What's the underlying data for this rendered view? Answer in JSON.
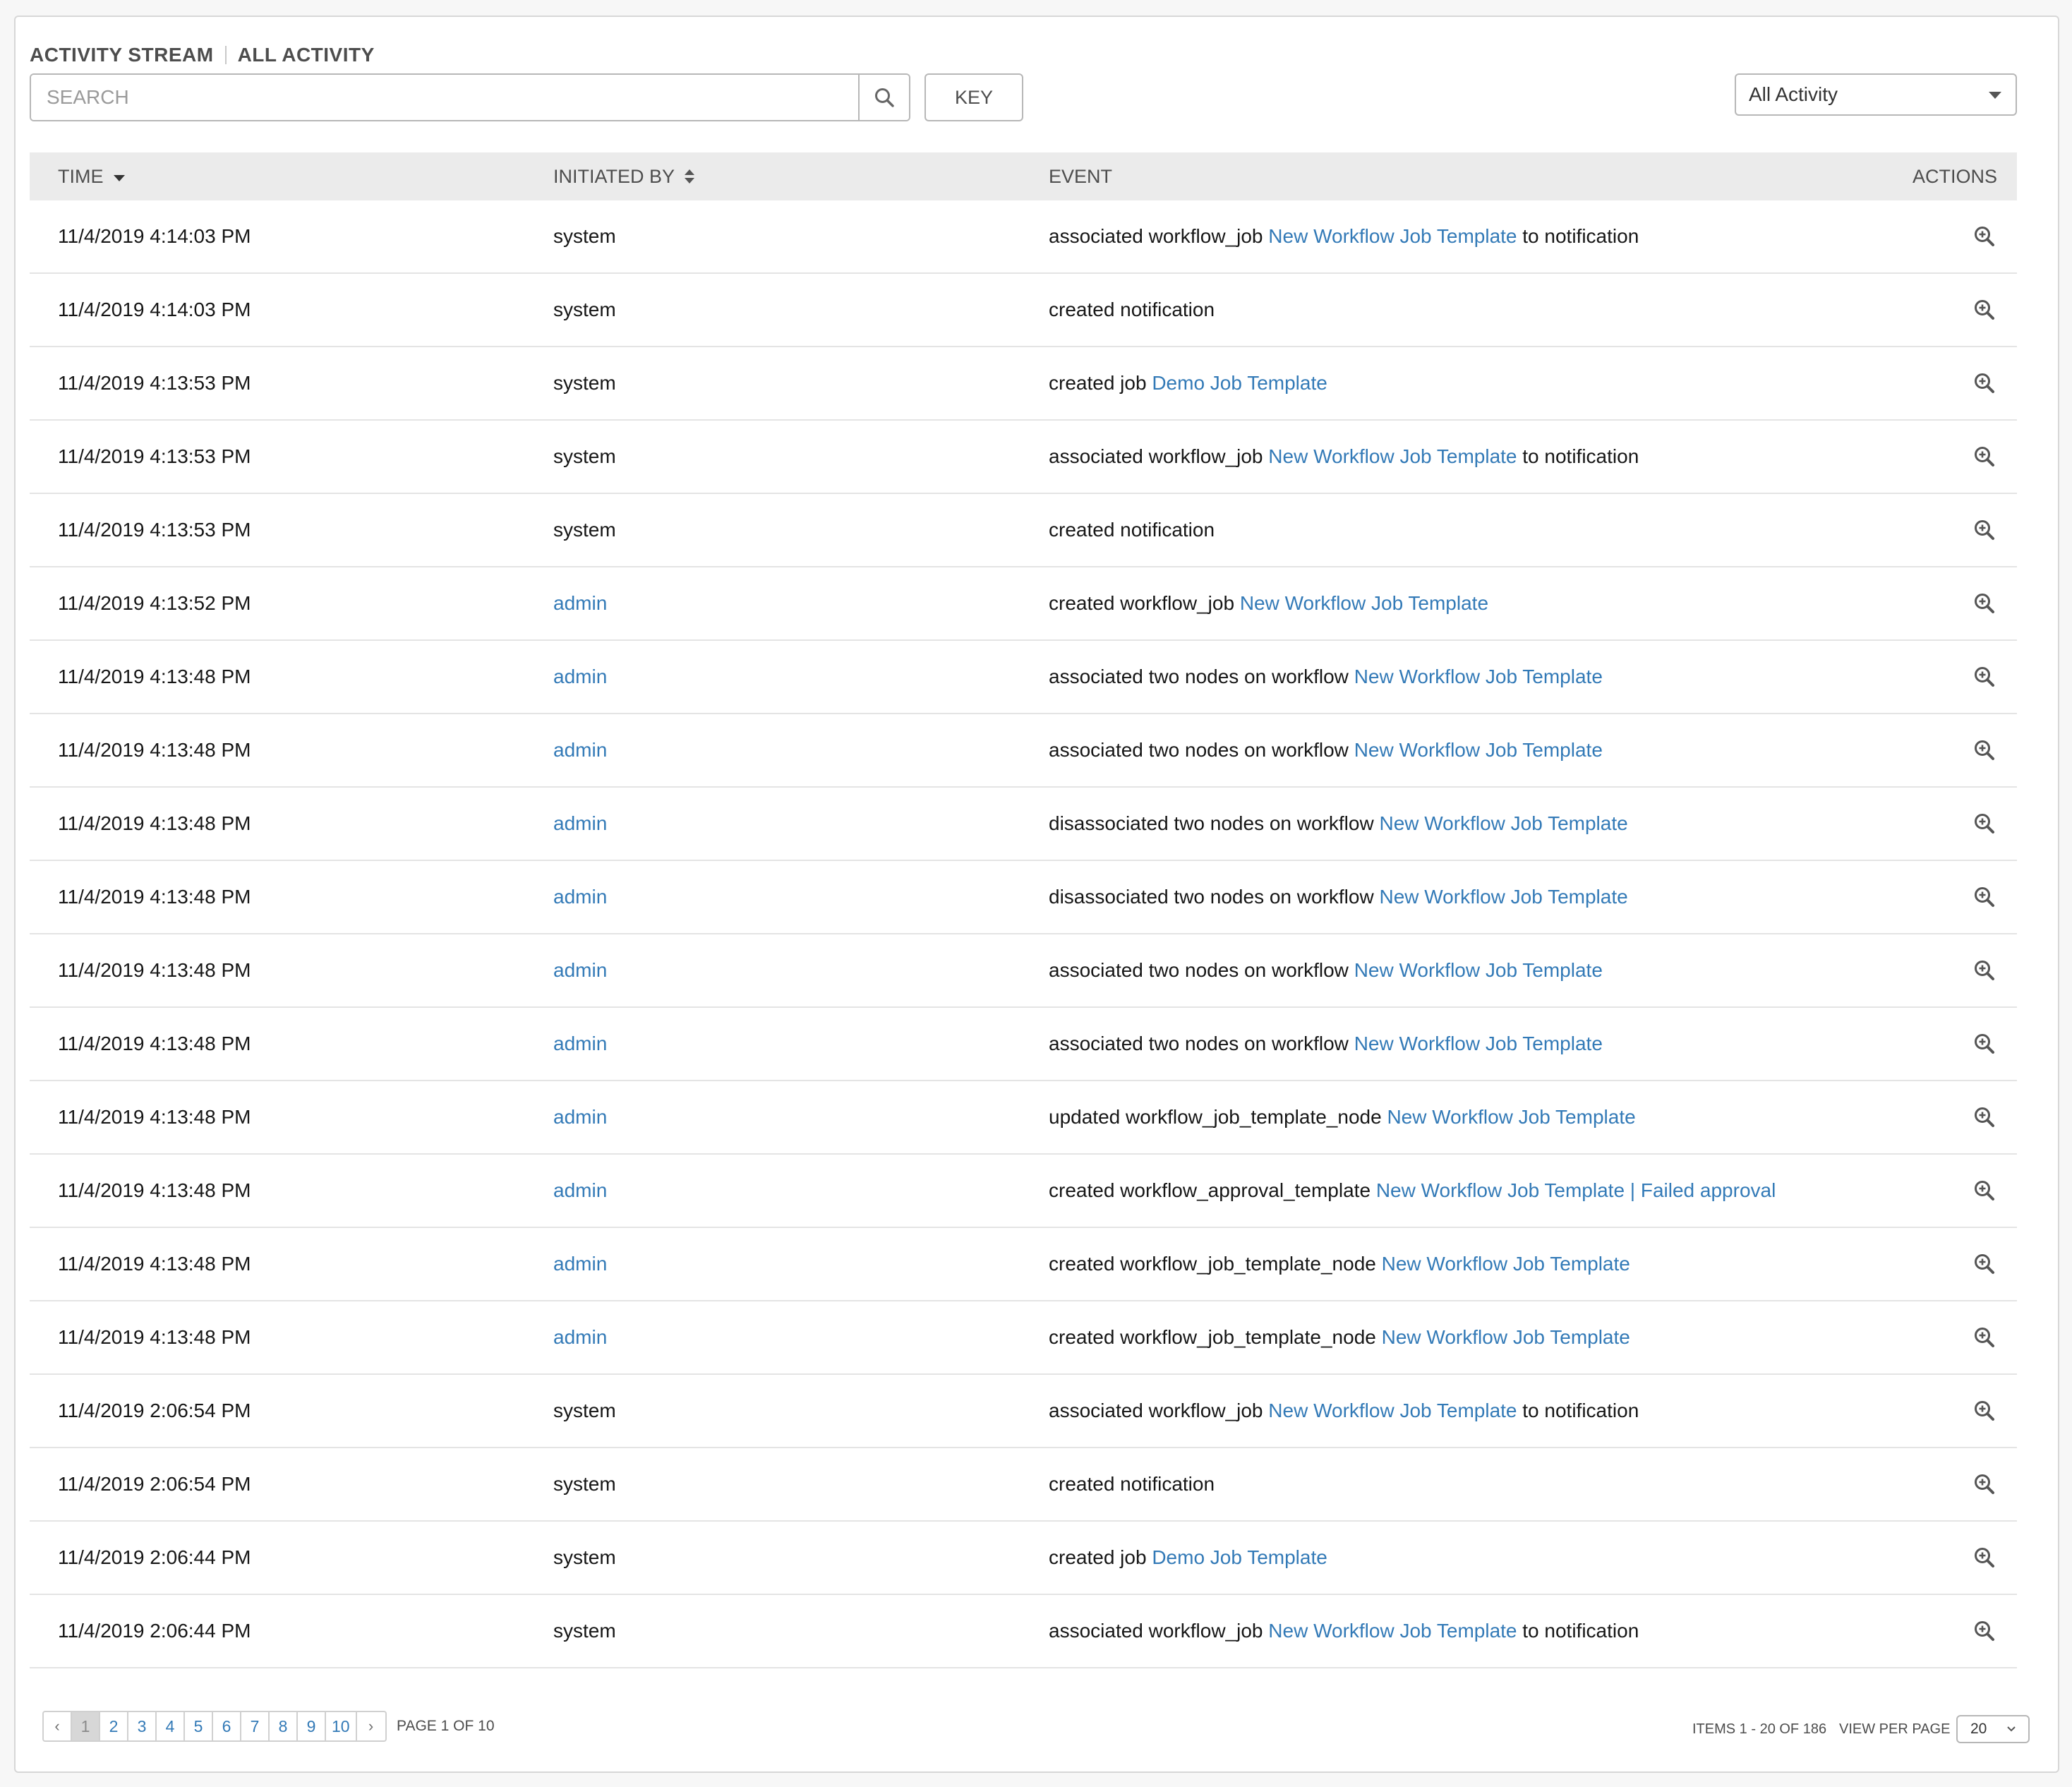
{
  "header": {
    "title": "ACTIVITY STREAM",
    "subtitle": "ALL ACTIVITY"
  },
  "search": {
    "placeholder": "SEARCH",
    "icon": "search-icon"
  },
  "toolbar": {
    "key_label": "KEY",
    "filter_selected": "All Activity"
  },
  "table": {
    "columns": {
      "time": "TIME",
      "initiated_by": "INITIATED BY",
      "event": "EVENT",
      "actions": "ACTIONS"
    },
    "rows": [
      {
        "time": "11/4/2019 4:14:03 PM",
        "initiated_by": "system",
        "initiator_link": false,
        "event_prefix": "associated workflow_job",
        "event_link": "New Workflow Job Template",
        "event_suffix": "to notification"
      },
      {
        "time": "11/4/2019 4:14:03 PM",
        "initiated_by": "system",
        "initiator_link": false,
        "event_prefix": "created notification",
        "event_link": "",
        "event_suffix": ""
      },
      {
        "time": "11/4/2019 4:13:53 PM",
        "initiated_by": "system",
        "initiator_link": false,
        "event_prefix": "created job",
        "event_link": "Demo Job Template",
        "event_suffix": ""
      },
      {
        "time": "11/4/2019 4:13:53 PM",
        "initiated_by": "system",
        "initiator_link": false,
        "event_prefix": "associated workflow_job",
        "event_link": "New Workflow Job Template",
        "event_suffix": "to notification"
      },
      {
        "time": "11/4/2019 4:13:53 PM",
        "initiated_by": "system",
        "initiator_link": false,
        "event_prefix": "created notification",
        "event_link": "",
        "event_suffix": ""
      },
      {
        "time": "11/4/2019 4:13:52 PM",
        "initiated_by": "admin",
        "initiator_link": true,
        "event_prefix": "created workflow_job",
        "event_link": "New Workflow Job Template",
        "event_suffix": ""
      },
      {
        "time": "11/4/2019 4:13:48 PM",
        "initiated_by": "admin",
        "initiator_link": true,
        "event_prefix": "associated two nodes on workflow",
        "event_link": "New Workflow Job Template",
        "event_suffix": ""
      },
      {
        "time": "11/4/2019 4:13:48 PM",
        "initiated_by": "admin",
        "initiator_link": true,
        "event_prefix": "associated two nodes on workflow",
        "event_link": "New Workflow Job Template",
        "event_suffix": ""
      },
      {
        "time": "11/4/2019 4:13:48 PM",
        "initiated_by": "admin",
        "initiator_link": true,
        "event_prefix": "disassociated two nodes on workflow",
        "event_link": "New Workflow Job Template",
        "event_suffix": ""
      },
      {
        "time": "11/4/2019 4:13:48 PM",
        "initiated_by": "admin",
        "initiator_link": true,
        "event_prefix": "disassociated two nodes on workflow",
        "event_link": "New Workflow Job Template",
        "event_suffix": ""
      },
      {
        "time": "11/4/2019 4:13:48 PM",
        "initiated_by": "admin",
        "initiator_link": true,
        "event_prefix": "associated two nodes on workflow",
        "event_link": "New Workflow Job Template",
        "event_suffix": ""
      },
      {
        "time": "11/4/2019 4:13:48 PM",
        "initiated_by": "admin",
        "initiator_link": true,
        "event_prefix": "associated two nodes on workflow",
        "event_link": "New Workflow Job Template",
        "event_suffix": ""
      },
      {
        "time": "11/4/2019 4:13:48 PM",
        "initiated_by": "admin",
        "initiator_link": true,
        "event_prefix": "updated workflow_job_template_node",
        "event_link": "New Workflow Job Template",
        "event_suffix": ""
      },
      {
        "time": "11/4/2019 4:13:48 PM",
        "initiated_by": "admin",
        "initiator_link": true,
        "event_prefix": "created workflow_approval_template",
        "event_link": "New Workflow Job Template | Failed approval",
        "event_suffix": ""
      },
      {
        "time": "11/4/2019 4:13:48 PM",
        "initiated_by": "admin",
        "initiator_link": true,
        "event_prefix": "created workflow_job_template_node",
        "event_link": "New Workflow Job Template",
        "event_suffix": ""
      },
      {
        "time": "11/4/2019 4:13:48 PM",
        "initiated_by": "admin",
        "initiator_link": true,
        "event_prefix": "created workflow_job_template_node",
        "event_link": "New Workflow Job Template",
        "event_suffix": ""
      },
      {
        "time": "11/4/2019 2:06:54 PM",
        "initiated_by": "system",
        "initiator_link": false,
        "event_prefix": "associated workflow_job",
        "event_link": "New Workflow Job Template",
        "event_suffix": "to notification"
      },
      {
        "time": "11/4/2019 2:06:54 PM",
        "initiated_by": "system",
        "initiator_link": false,
        "event_prefix": "created notification",
        "event_link": "",
        "event_suffix": ""
      },
      {
        "time": "11/4/2019 2:06:44 PM",
        "initiated_by": "system",
        "initiator_link": false,
        "event_prefix": "created job",
        "event_link": "Demo Job Template",
        "event_suffix": ""
      },
      {
        "time": "11/4/2019 2:06:44 PM",
        "initiated_by": "system",
        "initiator_link": false,
        "event_prefix": "associated workflow_job",
        "event_link": "New Workflow Job Template",
        "event_suffix": "to notification"
      }
    ],
    "action_icon": "zoom-in-icon"
  },
  "pagination": {
    "prev": "‹",
    "next": "›",
    "pages": [
      "1",
      "2",
      "3",
      "4",
      "5",
      "6",
      "7",
      "8",
      "9",
      "10"
    ],
    "current": "1",
    "page_info": "PAGE 1 OF 10",
    "items_label": "ITEMS  1 - 20 OF 186",
    "view_per_page_label": "VIEW PER PAGE",
    "per_page": "20"
  },
  "colors": {
    "link": "#337ab7",
    "header_bg": "#ebebeb",
    "border": "#e4e4e4"
  }
}
